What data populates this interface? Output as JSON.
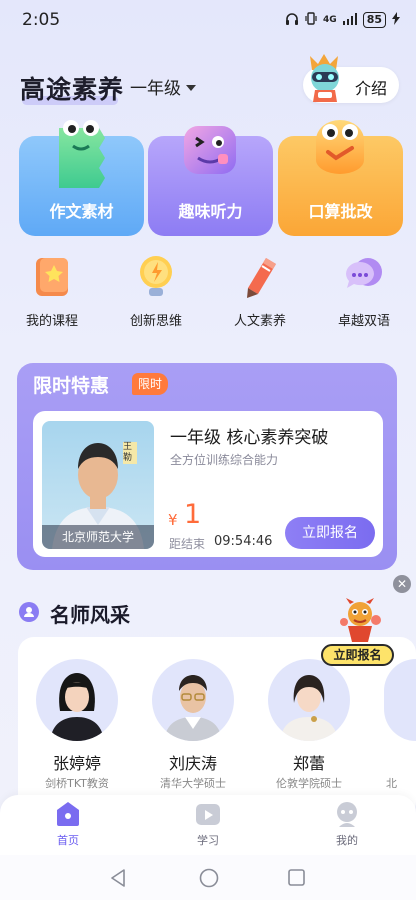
{
  "status_bar": {
    "time": "2:05",
    "signal": "4G",
    "battery": "85"
  },
  "header": {
    "brand": "高途素养",
    "grade": "一年级",
    "intro_label": "介绍"
  },
  "cards": [
    {
      "label": "作文素材",
      "color": "#6fb3f8"
    },
    {
      "label": "趣味听力",
      "color": "#9d8df6"
    },
    {
      "label": "口算批改",
      "color": "#fcb54a"
    }
  ],
  "shortcuts": [
    {
      "label": "我的课程",
      "icon": "book-star-icon"
    },
    {
      "label": "创新思维",
      "icon": "lightbulb-icon"
    },
    {
      "label": "人文素养",
      "icon": "pen-icon"
    },
    {
      "label": "卓越双语",
      "icon": "chat-bubble-icon"
    }
  ],
  "promo": {
    "title": "限时特惠",
    "tag": "限时",
    "teacher_school": "北京师范大学",
    "teacher_name_tag": "王勒",
    "course_title": "一年级 核心素养突破",
    "course_subtitle": "全方位训练综合能力",
    "price_symbol": "¥",
    "price": "1",
    "countdown_label": "距结束",
    "countdown": "09:54:46",
    "button": "立即报名"
  },
  "teachers_section": {
    "title": "名师风采",
    "float_button": "立即报名",
    "teachers": [
      {
        "name": "张婷婷",
        "desc": "剑桥TKT教资"
      },
      {
        "name": "刘庆涛",
        "desc": "清华大学硕士"
      },
      {
        "name": "郑蕾",
        "desc": "伦敦学院硕士"
      },
      {
        "name": "",
        "desc": "北"
      }
    ]
  },
  "tabbar": [
    {
      "label": "首页",
      "active": true
    },
    {
      "label": "学习",
      "active": false
    },
    {
      "label": "我的",
      "active": false
    }
  ],
  "colors": {
    "accent": "#7b6cf0",
    "price": "#ff6b3a",
    "tag": "#ff7a3c"
  }
}
